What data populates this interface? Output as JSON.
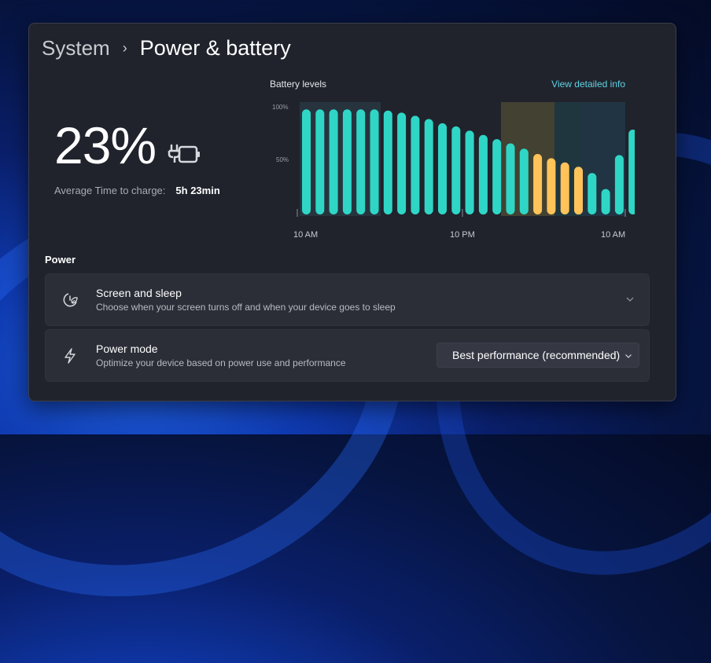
{
  "breadcrumb": {
    "parent": "System",
    "separator": "›",
    "current": "Power & battery"
  },
  "battery": {
    "percentage": "23%",
    "charge_label": "Average Time to charge:",
    "charge_value": "5h 23min"
  },
  "chart_section": {
    "title": "Battery levels",
    "link": "View detailed info"
  },
  "chart_data": {
    "type": "bar",
    "title": "",
    "x_tick_labels": [
      "10 AM",
      "10 PM",
      "10 AM"
    ],
    "y_tick_labels": [
      "100%",
      "50%"
    ],
    "ylim": [
      0,
      100
    ],
    "values": [
      99,
      99,
      99,
      99,
      99,
      99,
      98,
      96,
      93,
      90,
      86,
      83,
      79,
      75,
      71,
      67,
      62,
      57,
      53,
      49,
      45,
      39,
      24,
      56,
      80,
      91,
      91
    ],
    "state": [
      "normal",
      "normal",
      "normal",
      "normal",
      "normal",
      "normal",
      "normal",
      "normal",
      "normal",
      "normal",
      "normal",
      "normal",
      "normal",
      "normal",
      "normal",
      "normal",
      "normal",
      "saver",
      "saver",
      "saver",
      "saver",
      "normal",
      "normal",
      "normal",
      "normal",
      "normal",
      "normal"
    ],
    "colors": {
      "normal": "#2fd6c6",
      "saver": "#ffc35a"
    }
  },
  "power": {
    "section_label": "Power",
    "screen_sleep": {
      "title": "Screen and sleep",
      "description": "Choose when your screen turns off and when your device goes to sleep"
    },
    "power_mode": {
      "title": "Power mode",
      "description": "Optimize your device based on power use and performance",
      "selected": "Best performance (recommended)"
    }
  }
}
